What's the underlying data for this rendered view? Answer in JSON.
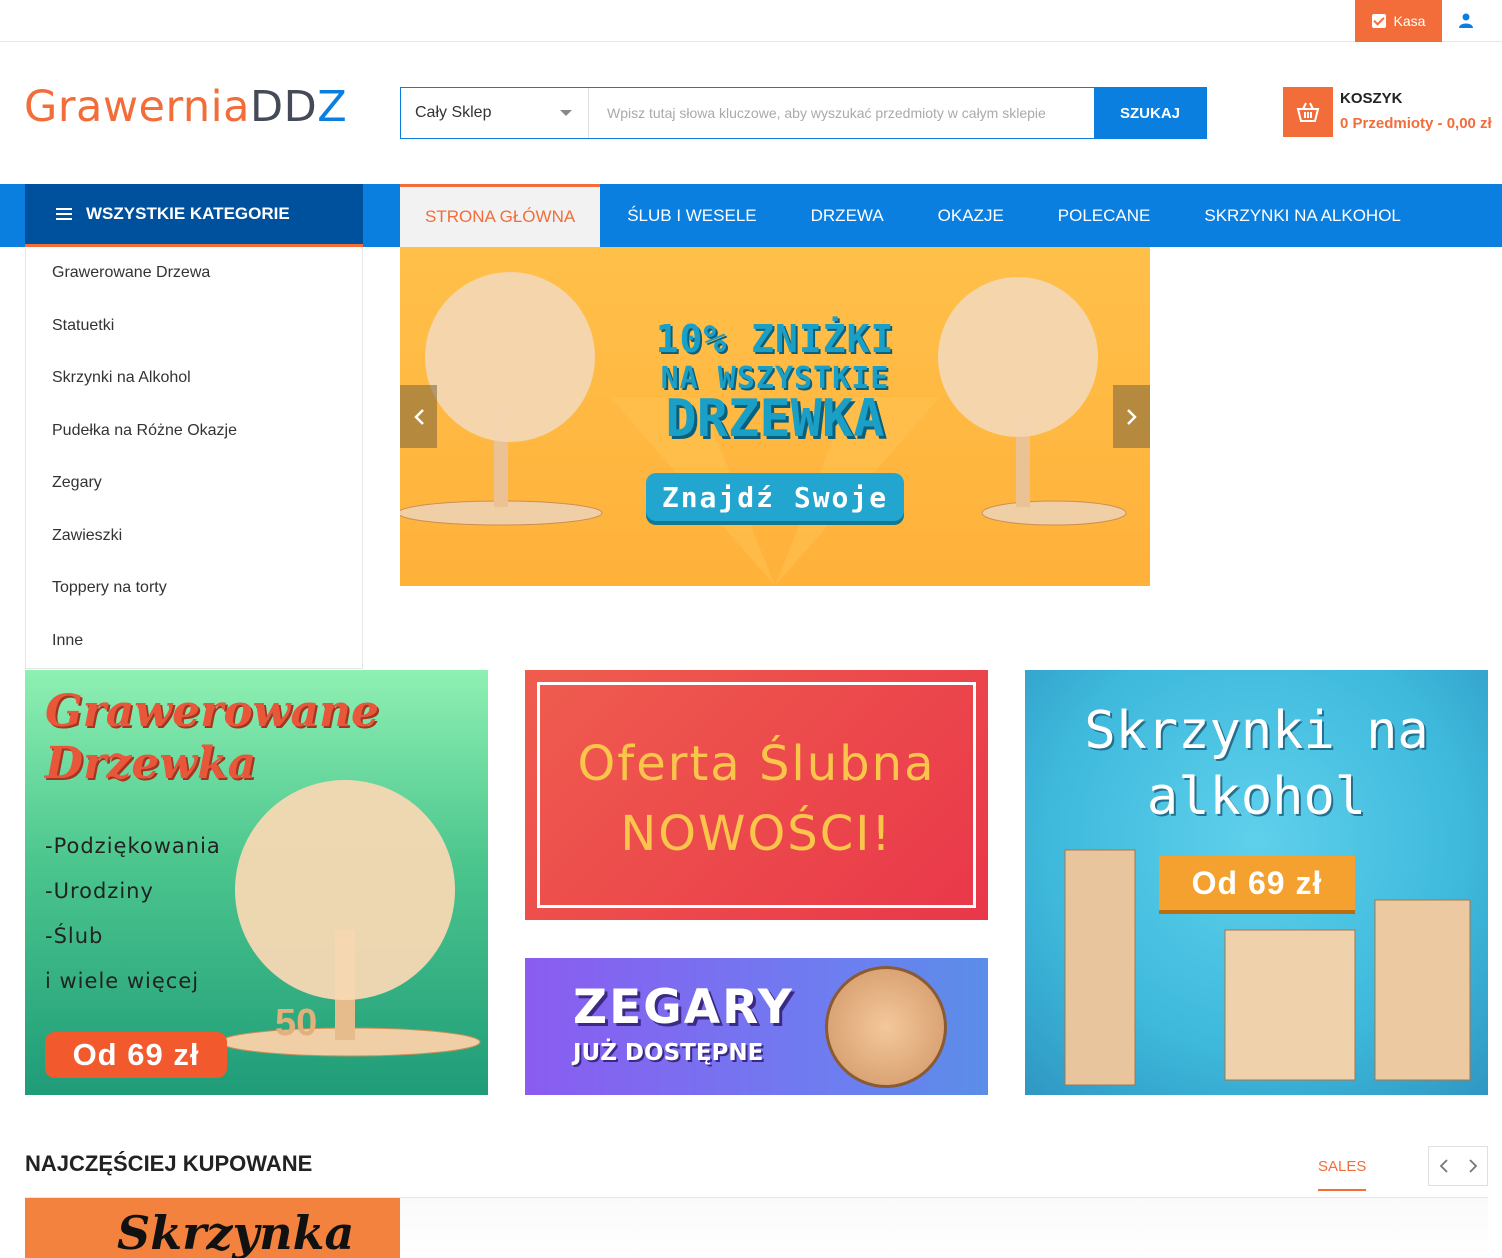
{
  "topbar": {
    "checkout_label": "Kasa",
    "user_icon": "user-icon"
  },
  "logo": {
    "part1": "Grawernia",
    "part2": "DD",
    "part3": "Z"
  },
  "search": {
    "category": "Cały Sklep",
    "placeholder": "Wpisz tutaj słowa kluczowe, aby wyszukać przedmioty w całym sklepie",
    "button_label": "SZUKAJ"
  },
  "cart": {
    "title": "KOSZYK",
    "summary": "0 Przedmioty - 0,00 zł"
  },
  "nav": {
    "all_categories": "WSZYSTKIE KATEGORIE",
    "tabs": [
      {
        "label": "STRONA GŁÓWNA",
        "active": true
      },
      {
        "label": "ŚLUB I WESELE"
      },
      {
        "label": "DRZEWA"
      },
      {
        "label": "OKAZJE"
      },
      {
        "label": "POLECANE"
      },
      {
        "label": "SKRZYNKI NA ALKOHOL"
      }
    ]
  },
  "sidebar": {
    "items": [
      "Grawerowane Drzewa",
      "Statuetki",
      "Skrzynki na Alkohol",
      "Pudełka na Różne Okazje",
      "Zegary",
      "Zawieszki",
      "Toppery na torty",
      "Inne"
    ]
  },
  "hero": {
    "line1": "10% ZNIŻKI",
    "line2": "NA WSZYSTKIE",
    "line3": "DRZEWKA",
    "cta": "Znajdź Swoje"
  },
  "banners": {
    "trees": {
      "title1": "Grawerowane",
      "title2": "Drzewka",
      "items": [
        "-Podziękowania",
        "-Urodziny",
        "-Ślub",
        "i wiele więcej"
      ],
      "price": "Od 69 zł"
    },
    "wedding": {
      "line1": "Oferta Ślubna",
      "line2": "NOWOŚCI!"
    },
    "clocks": {
      "line1": "ZEGARY",
      "line2": "JUŻ DOSTĘPNE"
    },
    "boxes": {
      "line1": "Skrzynki na",
      "line2": "alkohol",
      "price": "Od 69 zł"
    }
  },
  "section": {
    "title": "NAJCZĘŚCIEJ KUPOWANE",
    "tab": "SALES",
    "first_product_text": "Skrzynka"
  },
  "colors": {
    "accent": "#f26d3a",
    "primary": "#0b7fe0",
    "dark_primary": "#00519d"
  }
}
